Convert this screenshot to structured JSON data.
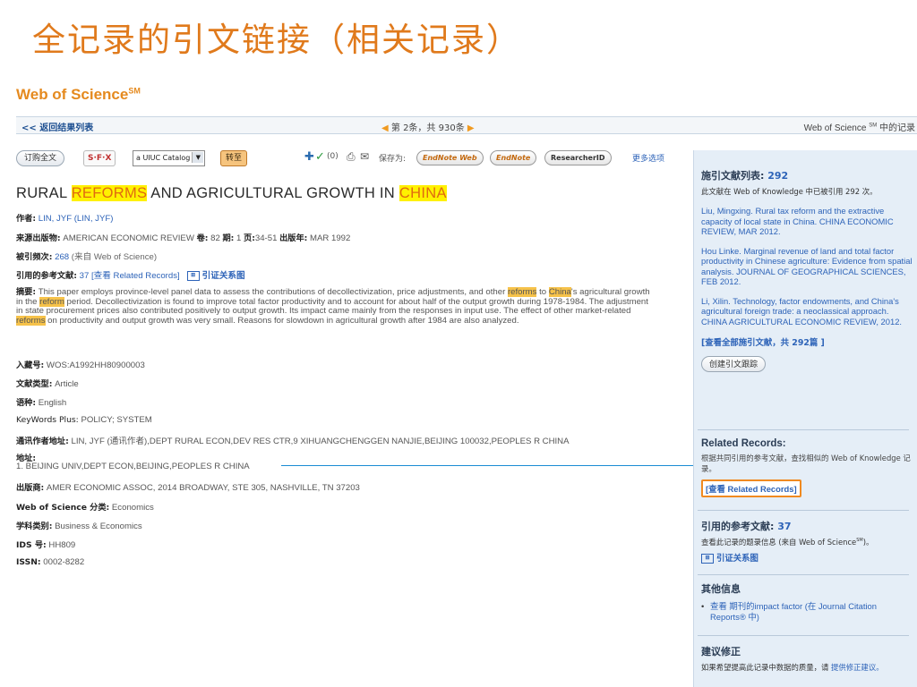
{
  "slide_title": "全记录的引文链接（相关记录）",
  "logo": {
    "text": "Web of Science",
    "mark": "SM"
  },
  "nav": {
    "back": "<< 返回结果列表",
    "pager": "第 2条，共 930条",
    "right": "Web of Science",
    "right_sup": "SM",
    "right_suffix": "中的记录"
  },
  "toolbar": {
    "order_fulltext": "订购全文",
    "sfx": "S·F·X",
    "catalog": "a UIUC Catalog",
    "go": "转至",
    "marked_count": "(0)",
    "save_to": "保存为:",
    "endnote_web": "EndNote Web",
    "endnote": "EndNote",
    "researcherid": "ResearcherID",
    "more_options": "更多选项"
  },
  "article": {
    "title_parts": [
      "RURAL ",
      "REFORMS",
      " AND AGRICULTURAL GROWTH IN ",
      "CHINA"
    ],
    "author_label": "作者:",
    "author": "LIN, JYF (LIN, JYF)",
    "source_label": "来源出版物:",
    "source": "AMERICAN ECONOMIC REVIEW",
    "vol_label": "卷:",
    "vol": "82",
    "issue_label": "期:",
    "issue": "1",
    "pages_label": "页:",
    "pages": "34-51",
    "pubyear_label": "出版年:",
    "pubyear": "MAR 1992",
    "times_cited_label": "被引频次:",
    "times_cited": "268",
    "times_cited_suffix": "(来自 Web of Science)",
    "refs_label": "引用的参考文献:",
    "refs_count": "37",
    "refs_link": "[查看 Related Records]",
    "citation_map": "引证关系图",
    "abstract_label": "摘要:",
    "abstract_1": "This paper employs province-level panel data to assess the contributions of decollectivization, price adjustments, and other ",
    "abstract_hl1": "reforms",
    "abstract_2": " to ",
    "abstract_hl2": "China",
    "abstract_3": "'s agricultural growth in the ",
    "abstract_hl3": "reform",
    "abstract_4": " period. Decollectivization is found to improve total factor productivity and to account for about half of the output growth during 1978-1984. The adjustment in state procurement prices also contributed positively to output growth. Its impact came mainly from the responses in input use. The effect of other market-related ",
    "abstract_hl4": "reforms",
    "abstract_5": " on productivity and output growth was very small. Reasons for slowdown in agricultural growth after 1984 are also analyzed.",
    "accession_label": "入藏号:",
    "accession": "WOS:A1992HH80900003",
    "doctype_label": "文献类型:",
    "doctype": "Article",
    "lang_label": "语种:",
    "lang": "English",
    "kwplus_label": "KeyWords Plus:",
    "kwplus": "POLICY; SYSTEM",
    "corr_label": "通讯作者地址:",
    "corr": "LIN, JYF (通讯作者),DEPT RURAL ECON,DEV RES CTR,9 XIHUANGCHENGGEN NANJIE,BEIJING 100032,PEOPLES R CHINA",
    "addr_label": "地址:",
    "addr": "1. BEIJING UNIV,DEPT ECON,BEIJING,PEOPLES R CHINA",
    "publisher_label": "出版商:",
    "publisher": "AMER ECONOMIC ASSOC, 2014 BROADWAY, STE 305, NASHVILLE, TN 37203",
    "wos_cat_label": "Web of Science 分类:",
    "wos_cat": "Economics",
    "subject_label": "学科类别:",
    "subject": "Business & Economics",
    "ids_label": "IDS 号:",
    "ids": "HH809",
    "issn_label": "ISSN:",
    "issn": "0002-8282"
  },
  "sidebar": {
    "citing_title": "施引文献列表:",
    "citing_count": "292",
    "citing_desc": "此文献在 Web of Knowledge 中已被引用 292 次。",
    "citing": [
      {
        "author": "Liu, Mingxing.",
        "text": "Rural tax reform and the extractive capacity of local state in China. CHINA ECONOMIC REVIEW, MAR 2012."
      },
      {
        "author": "Hou Linke.",
        "text": "Marginal revenue of land and total factor productivity in Chinese agriculture: Evidence from spatial analysis. JOURNAL OF GEOGRAPHICAL SCIENCES, FEB 2012."
      },
      {
        "author": "Li, Xilin.",
        "text": "Technology, factor endowments, and China's agricultural foreign trade: a neoclassical approach. CHINA AGRICULTURAL ECONOMIC REVIEW, 2012."
      }
    ],
    "view_all": "[查看全部施引文献，共 292篇 ]",
    "create_alert": "创建引文跟踪",
    "related_title": "Related Records:",
    "related_desc": "根据共同引用的参考文献，查找相似的 Web of Knowledge 记录。",
    "related_btn": "[查看 Related Records]",
    "refs_title": "引用的参考文献:",
    "refs_count": "37",
    "refs_desc": "查看此记录的题录信息 (来自 Web of Science",
    "refs_desc_sup": "SM",
    "refs_desc_end": ")。",
    "citation_map": "引证关系图",
    "other_title": "其他信息",
    "other_item": "查看 期刊的impact factor (在 Journal Citation Reports® 中)",
    "suggest_title": "建议修正",
    "suggest_desc": "如果希望提高此记录中数据的质量，请 ",
    "suggest_link": "提供修正建议。"
  }
}
